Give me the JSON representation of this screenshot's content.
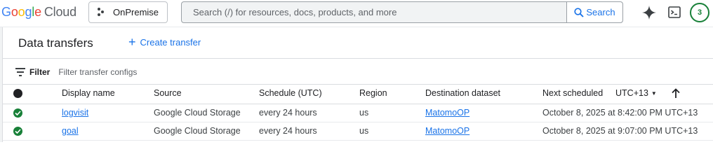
{
  "header": {
    "logo_letters": [
      "G",
      "o",
      "o",
      "g",
      "l",
      "e"
    ],
    "logo_product": "Cloud",
    "project_name": "OnPremise",
    "search_placeholder": "Search (/) for resources, docs, products, and more",
    "search_button": "Search",
    "notification_count": "3"
  },
  "page": {
    "title": "Data transfers",
    "create_label": "Create transfer"
  },
  "filter": {
    "label": "Filter",
    "placeholder": "Filter transfer configs"
  },
  "table": {
    "columns": {
      "display_name": "Display name",
      "source": "Source",
      "schedule": "Schedule (UTC)",
      "region": "Region",
      "destination": "Destination dataset",
      "next_scheduled": "Next scheduled",
      "timezone": "UTC+13"
    },
    "rows": [
      {
        "status": "success",
        "display_name": "logvisit",
        "source": "Google Cloud Storage",
        "schedule": "every 24 hours",
        "region": "us",
        "destination": "MatomoOP",
        "next_scheduled": "October 8, 2025 at 8:42:00 PM UTC+13"
      },
      {
        "status": "success",
        "display_name": "goal",
        "source": "Google Cloud Storage",
        "schedule": "every 24 hours",
        "region": "us",
        "destination": "MatomoOP",
        "next_scheduled": "October 8, 2025 at 9:07:00 PM UTC+13"
      }
    ]
  },
  "icons": {
    "status_header": "circle-icon",
    "sort": "arrow-up-icon",
    "assistant": "gemini-spark-icon",
    "shell": "terminal-icon",
    "status_success": "check-circle-icon"
  },
  "colors": {
    "accent": "#1a73e8",
    "success": "#188038"
  }
}
